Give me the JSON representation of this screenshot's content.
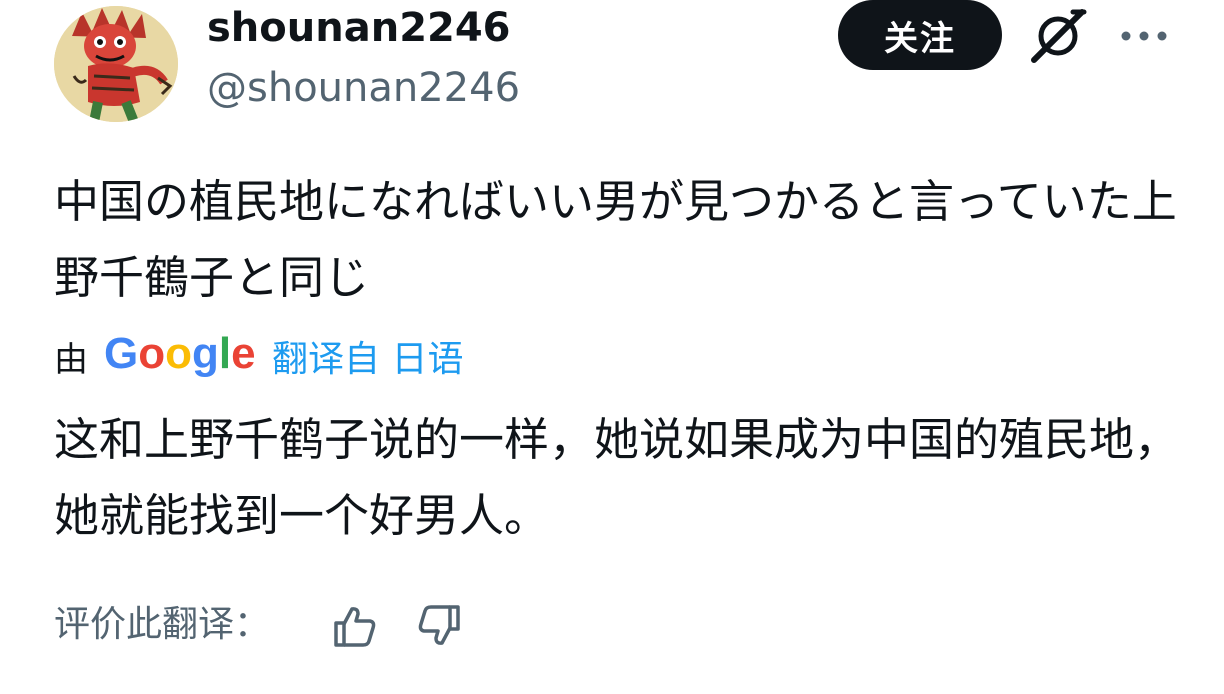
{
  "author": {
    "display_name": "shounan2246",
    "handle": "@shounan2246",
    "avatar_icon": "demon-figure-avatar"
  },
  "header": {
    "follow_label": "关注",
    "grok_icon": "grok-slash-icon",
    "more_icon": "more-horizontal-icon"
  },
  "post": {
    "original_text": "中国の植民地になればいい男が見つかると言っていた上野千鶴子と同じ"
  },
  "translation": {
    "by_label": "由",
    "provider": "Google",
    "translated_from": "翻译自 日语",
    "text": "这和上野千鹤子说的一样，她说如果成为中国的殖民地，她就能找到一个好男人。",
    "rate_label": "评价此翻译：",
    "thumbs_up_icon": "thumbs-up-icon",
    "thumbs_down_icon": "thumbs-down-icon"
  },
  "colors": {
    "text_primary": "#0f1419",
    "text_secondary": "#536471",
    "link_blue": "#1d9bf0",
    "google_blue": "#4285F4",
    "google_red": "#EA4335",
    "google_yellow": "#FBBC05",
    "google_green": "#34A853"
  }
}
